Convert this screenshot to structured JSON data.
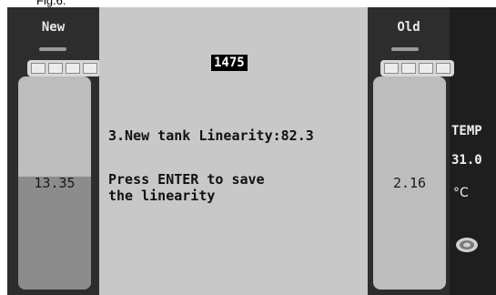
{
  "caption": "Fig.6.",
  "counter": "1475",
  "message": {
    "line1": "3.New tank Linearity:82.3",
    "line2": "Press ENTER to save",
    "line3": "the linearity"
  },
  "tanks": {
    "new": {
      "title": "New",
      "value": "13.35",
      "fill_fraction": 0.53
    },
    "old": {
      "title": "Old",
      "value": "2.16",
      "fill_fraction": 0.0
    }
  },
  "temperature": {
    "label": "TEMP",
    "value": "31.0",
    "unit": "°C"
  },
  "icons": {
    "settings": "gear-icon"
  },
  "colors": {
    "screen_bg": "#1e1e1e",
    "panel_bg": "#2d2d2d",
    "center_bg": "#c8c8c8",
    "tank_fill": "#8c8c8c"
  }
}
